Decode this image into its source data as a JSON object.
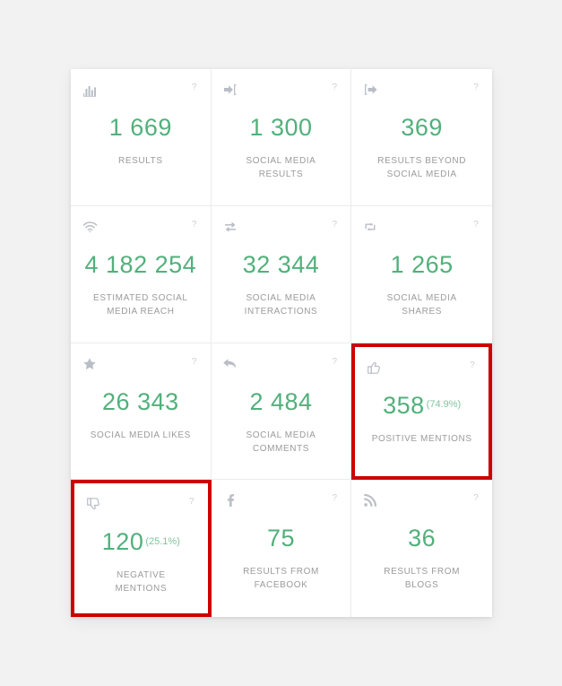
{
  "theme": {
    "page_background": "#f2f2f2",
    "card_background": "#ffffff",
    "value_color": "#52b07b",
    "percent_color": "#7ec49c",
    "label_color": "#9b9b9b",
    "icon_color": "#b9bec6",
    "highlight_border_color": "#cc0000"
  },
  "help_marker": "?",
  "cards": [
    {
      "icon": "bar-chart-icon",
      "value": "1 669",
      "percent": "",
      "label": "RESULTS",
      "highlighted": false
    },
    {
      "icon": "sign-in-arrow-icon",
      "value": "1 300",
      "percent": "",
      "label": "SOCIAL MEDIA RESULTS",
      "highlighted": false
    },
    {
      "icon": "sign-out-arrow-icon",
      "value": "369",
      "percent": "",
      "label": "RESULTS BEYOND SOCIAL MEDIA",
      "highlighted": false
    },
    {
      "icon": "wifi-signal-icon",
      "value": "4 182 254",
      "percent": "",
      "label": "ESTIMATED SOCIAL MEDIA REACH",
      "highlighted": false
    },
    {
      "icon": "exchange-arrows-icon",
      "value": "32 344",
      "percent": "",
      "label": "SOCIAL MEDIA INTERACTIONS",
      "highlighted": false
    },
    {
      "icon": "retweet-share-icon",
      "value": "1 265",
      "percent": "",
      "label": "SOCIAL MEDIA SHARES",
      "highlighted": false
    },
    {
      "icon": "star-icon",
      "value": "26 343",
      "percent": "",
      "label": "SOCIAL MEDIA LIKES",
      "highlighted": false
    },
    {
      "icon": "reply-arrow-icon",
      "value": "2 484",
      "percent": "",
      "label": "SOCIAL MEDIA COMMENTS",
      "highlighted": false
    },
    {
      "icon": "thumbs-up-icon",
      "value": "358",
      "percent": "(74.9%)",
      "label": "POSITIVE MENTIONS",
      "highlighted": true
    },
    {
      "icon": "thumbs-down-icon",
      "value": "120",
      "percent": "(25.1%)",
      "label": "NEGATIVE MENTIONS",
      "highlighted": true
    },
    {
      "icon": "facebook-icon",
      "value": "75",
      "percent": "",
      "label": "RESULTS FROM FACEBOOK",
      "highlighted": false
    },
    {
      "icon": "rss-feed-icon",
      "value": "36",
      "percent": "",
      "label": "RESULTS FROM BLOGS",
      "highlighted": false
    }
  ]
}
